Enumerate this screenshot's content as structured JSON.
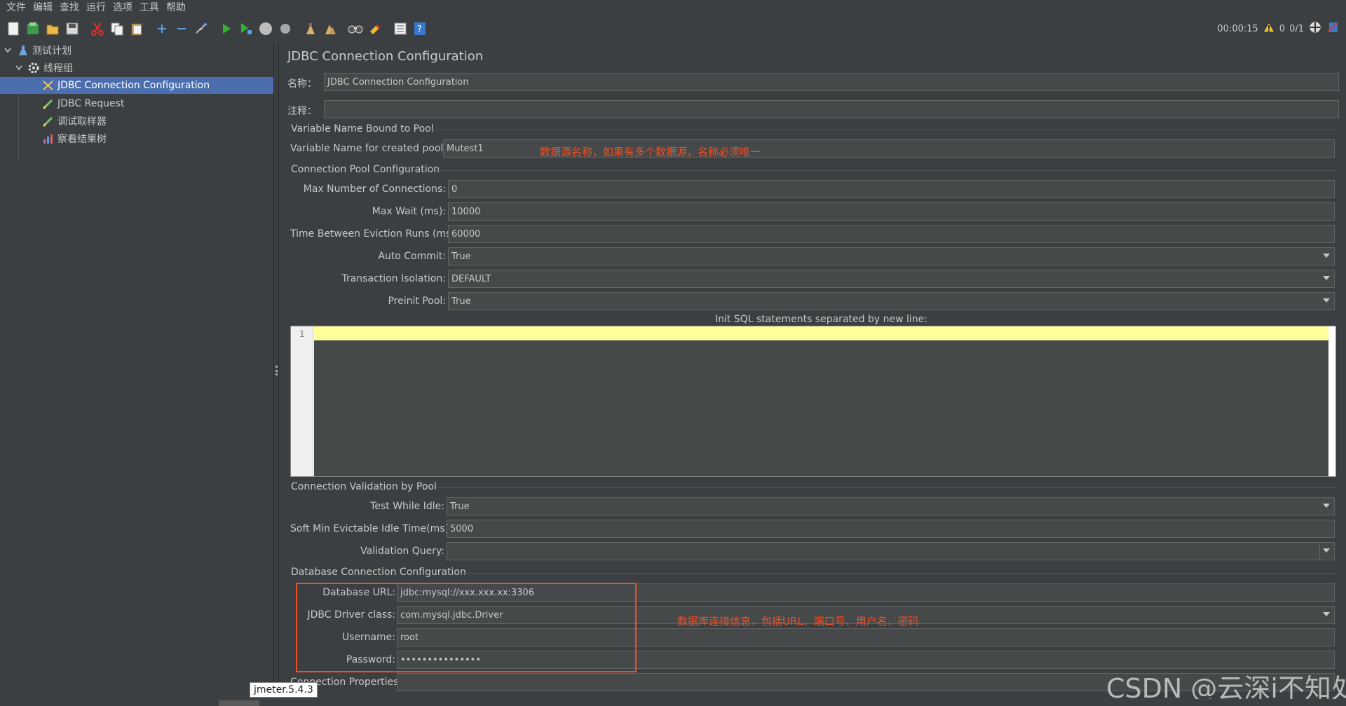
{
  "menu": [
    "文件",
    "编辑",
    "查找",
    "运行",
    "选项",
    "工具",
    "帮助"
  ],
  "toolbar": {
    "icons": [
      "new-icon",
      "templates-icon",
      "open-icon",
      "save-icon",
      "cut-icon",
      "copy-icon",
      "paste-icon",
      "expand-icon",
      "collapse-icon",
      "toggle-icon",
      "start-icon",
      "start-no-pause-icon",
      "stop-icon",
      "shutdown-icon",
      "clear-icon",
      "clear-all-icon",
      "search-icon",
      "reset-search-icon",
      "function-helper-icon",
      "help-icon"
    ],
    "timer": "00:00:15",
    "warnings": "0",
    "threads": "0/1"
  },
  "tree": {
    "items": [
      {
        "label": "测试计划",
        "icon": "test-plan-icon"
      },
      {
        "label": "线程组",
        "icon": "thread-group-icon"
      },
      {
        "label": "JDBC Connection Configuration",
        "icon": "config-icon"
      },
      {
        "label": "JDBC Request",
        "icon": "sampler-icon"
      },
      {
        "label": "调试取样器",
        "icon": "sampler-icon"
      },
      {
        "label": "察看结果树",
        "icon": "listener-icon"
      }
    ]
  },
  "main": {
    "title": "JDBC Connection Configuration",
    "name_label": "名称：",
    "name_value": "JDBC Connection Configuration",
    "comment_label": "注释：",
    "comment_value": "",
    "section_var": "Variable Name Bound to Pool",
    "var_label": "Variable Name for created pool:",
    "var_value": "Mutest1",
    "annotation_var": "数据源名称，如果有多个数据源，名称必须唯一",
    "section_pool": "Connection Pool Configuration",
    "max_conn_label": "Max Number of Connections:",
    "max_conn_value": "0",
    "max_wait_label": "Max Wait (ms):",
    "max_wait_value": "10000",
    "eviction_label": "Time Between Eviction Runs (ms):",
    "eviction_value": "60000",
    "auto_commit_label": "Auto Commit:",
    "auto_commit_value": "True",
    "isolation_label": "Transaction Isolation:",
    "isolation_value": "DEFAULT",
    "preinit_label": "Preinit Pool:",
    "preinit_value": "True",
    "init_sql_label": "Init SQL statements separated by new line:",
    "init_sql_line": "1",
    "section_validation": "Connection Validation by Pool",
    "test_idle_label": "Test While Idle:",
    "test_idle_value": "True",
    "soft_min_label": "Soft Min Evictable Idle Time(ms):",
    "soft_min_value": "5000",
    "validation_query_label": "Validation Query:",
    "validation_query_value": "",
    "section_db": "Database Connection Configuration",
    "db_url_label": "Database URL:",
    "db_url_value": "jdbc:mysql://xxx.xxx.xx:3306",
    "driver_label": "JDBC Driver class:",
    "driver_value": "com.mysql.jdbc.Driver",
    "username_label": "Username:",
    "username_value": "root",
    "password_label": "Password:",
    "password_value": "•••••••••••••••",
    "annotation_db": "数据库连接信息，包括URL、端口号、用户名、密码",
    "conn_props_label": "Connection Properties:",
    "conn_props_value": ""
  },
  "tooltip": "jmeter.5.4.3",
  "watermark": "CSDN @云深i不知处",
  "colors": {
    "selection": "#4b6eaf",
    "annotation": "#e8522b",
    "background": "#3c3f41"
  }
}
